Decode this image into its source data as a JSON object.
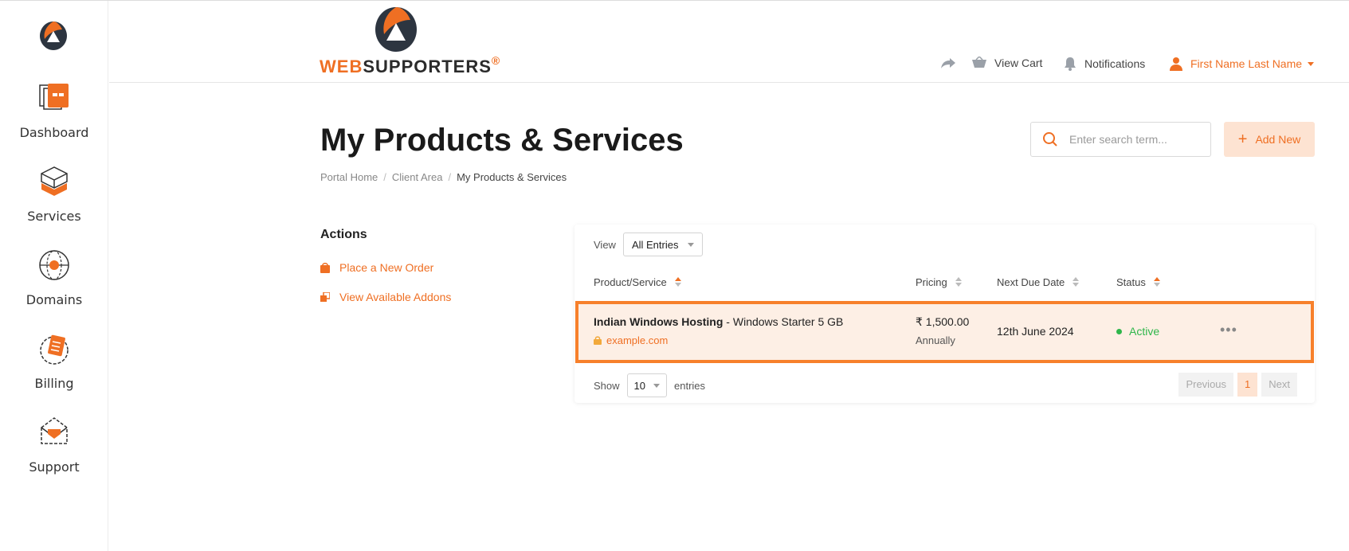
{
  "brand": {
    "web": "WEB",
    "supporters": "SUPPORTERS",
    "registered": "®"
  },
  "sidebar": {
    "items": [
      {
        "label": "Dashboard",
        "icon": "dashboard-icon"
      },
      {
        "label": "Services",
        "icon": "services-icon"
      },
      {
        "label": "Domains",
        "icon": "globe-icon"
      },
      {
        "label": "Billing",
        "icon": "billing-icon"
      },
      {
        "label": "Support",
        "icon": "support-icon"
      }
    ]
  },
  "header": {
    "view_cart": "View Cart",
    "notifications": "Notifications",
    "user_name": "First Name Last Name"
  },
  "page": {
    "title": "My Products & Services",
    "breadcrumb": [
      "Portal Home",
      "Client Area",
      "My Products & Services"
    ],
    "search_placeholder": "Enter search term...",
    "add_new": "Add New"
  },
  "actions": {
    "title": "Actions",
    "links": [
      "Place a New Order",
      "View Available Addons"
    ]
  },
  "table": {
    "view_label": "View",
    "view_value": "All Entries",
    "columns": [
      "Product/Service",
      "Pricing",
      "Next Due Date",
      "Status"
    ],
    "rows": [
      {
        "product": "Indian Windows Hosting",
        "plan": " - Windows Starter 5 GB",
        "domain": "example.com",
        "price": "₹ 1,500.00",
        "cycle": "Annually",
        "due_date": "12th June 2024",
        "status": "Active",
        "more": "•••"
      }
    ],
    "show_label": "Show",
    "show_value": "10",
    "entries_label": "entries",
    "pager": {
      "previous": "Previous",
      "current": "1",
      "next": "Next"
    }
  },
  "colors": {
    "accent": "#ef6f23",
    "active": "#2fb64b",
    "row_highlight": "#fdefe5"
  }
}
